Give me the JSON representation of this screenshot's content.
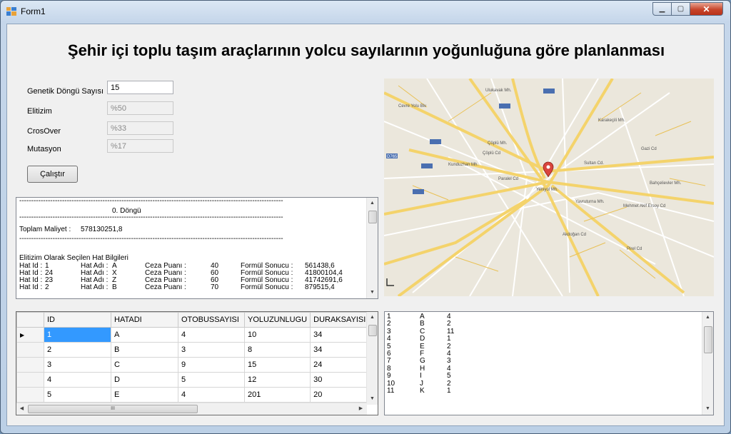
{
  "window": {
    "title": "Form1"
  },
  "heading": "Şehir içi toplu taşım araçlarının yolcu sayılarının yoğunluğuna göre planlanması",
  "form": {
    "cycles_label": "Genetik Döngü Sayısı",
    "cycles_value": "15",
    "elitism_label": "Elitizim",
    "elitism_value": "%50",
    "crossover_label": "CrosOver",
    "crossover_value": "%33",
    "mutation_label": "Mutasyon",
    "mutation_value": "%17",
    "run_button": "Çalıştır"
  },
  "log": {
    "separator": "---------------------------------------------------------------------------------------------------------------",
    "cycle_title": "0. Döngü",
    "total_cost_label": "Toplam Maliyet :",
    "total_cost_value": "578130251,8",
    "elite_header": "Elitizim Olarak Seçilen Hat Bilgileri",
    "rows": [
      {
        "id_label": "Hat Id :",
        "id": "1",
        "name_label": "Hat Adı :",
        "name": "A",
        "penalty_label": "Ceza Puanı :",
        "penalty": "40",
        "formula_label": "Formül Sonucu :",
        "formula": "561438,6"
      },
      {
        "id_label": "Hat Id :",
        "id": "24",
        "name_label": "Hat Adı :",
        "name": "X",
        "penalty_label": "Ceza Puanı :",
        "penalty": "60",
        "formula_label": "Formül Sonucu :",
        "formula": "41800104,4"
      },
      {
        "id_label": "Hat Id :",
        "id": "23",
        "name_label": "Hat Adı :",
        "name": "Z",
        "penalty_label": "Ceza Puanı :",
        "penalty": "60",
        "formula_label": "Formül Sonucu :",
        "formula": "41742691,6"
      },
      {
        "id_label": "Hat Id :",
        "id": "2",
        "name_label": "Hat Adı :",
        "name": "B",
        "penalty_label": "Ceza Puanı :",
        "penalty": "70",
        "formula_label": "Formül Sonucu :",
        "formula": "879515,4"
      }
    ]
  },
  "map": {
    "labels": [
      "Ulukavak Mh.",
      "Karakeçili Mh.",
      "Çöplü Mh.",
      "Kunduzhan Mh.",
      "Yeniyol Mh.",
      "Yavruturna Mh.",
      "Bahçelievler Mh.",
      "Sultan Cd.",
      "Paralel Cd",
      "Akdoğan Cd",
      "Gazi Cd",
      "Cevre Yolu Blv",
      "Mehmet Akif Ersoy Cd",
      "Pirel Cd",
      "Çöplü Cd",
      "D765"
    ]
  },
  "grid": {
    "columns": [
      "ID",
      "HATADI",
      "OTOBUSSAYISI",
      "YOLUZUNLUGU",
      "DURAKSAYISI"
    ],
    "rows": [
      [
        "1",
        "A",
        "4",
        "10",
        "34"
      ],
      [
        "2",
        "B",
        "3",
        "8",
        "34"
      ],
      [
        "3",
        "C",
        "9",
        "15",
        "24"
      ],
      [
        "4",
        "D",
        "5",
        "12",
        "30"
      ],
      [
        "5",
        "E",
        "4",
        "201",
        "20"
      ]
    ],
    "scroll_mark": "III"
  },
  "list": {
    "rows": [
      [
        "1",
        "A",
        "4"
      ],
      [
        "2",
        "B",
        "2"
      ],
      [
        "3",
        "C",
        "11"
      ],
      [
        "4",
        "D",
        "1"
      ],
      [
        "5",
        "E",
        "2"
      ],
      [
        "6",
        "F",
        "4"
      ],
      [
        "7",
        "G",
        "3"
      ],
      [
        "8",
        "H",
        "4"
      ],
      [
        "9",
        "I",
        "5"
      ],
      [
        "10",
        "J",
        "2"
      ],
      [
        "11",
        "K",
        "1"
      ]
    ]
  },
  "colors": {
    "selection": "#3399ff",
    "close_button": "#c7452b",
    "road_major": "#f4d36b",
    "map_bg": "#ebe7dc"
  }
}
